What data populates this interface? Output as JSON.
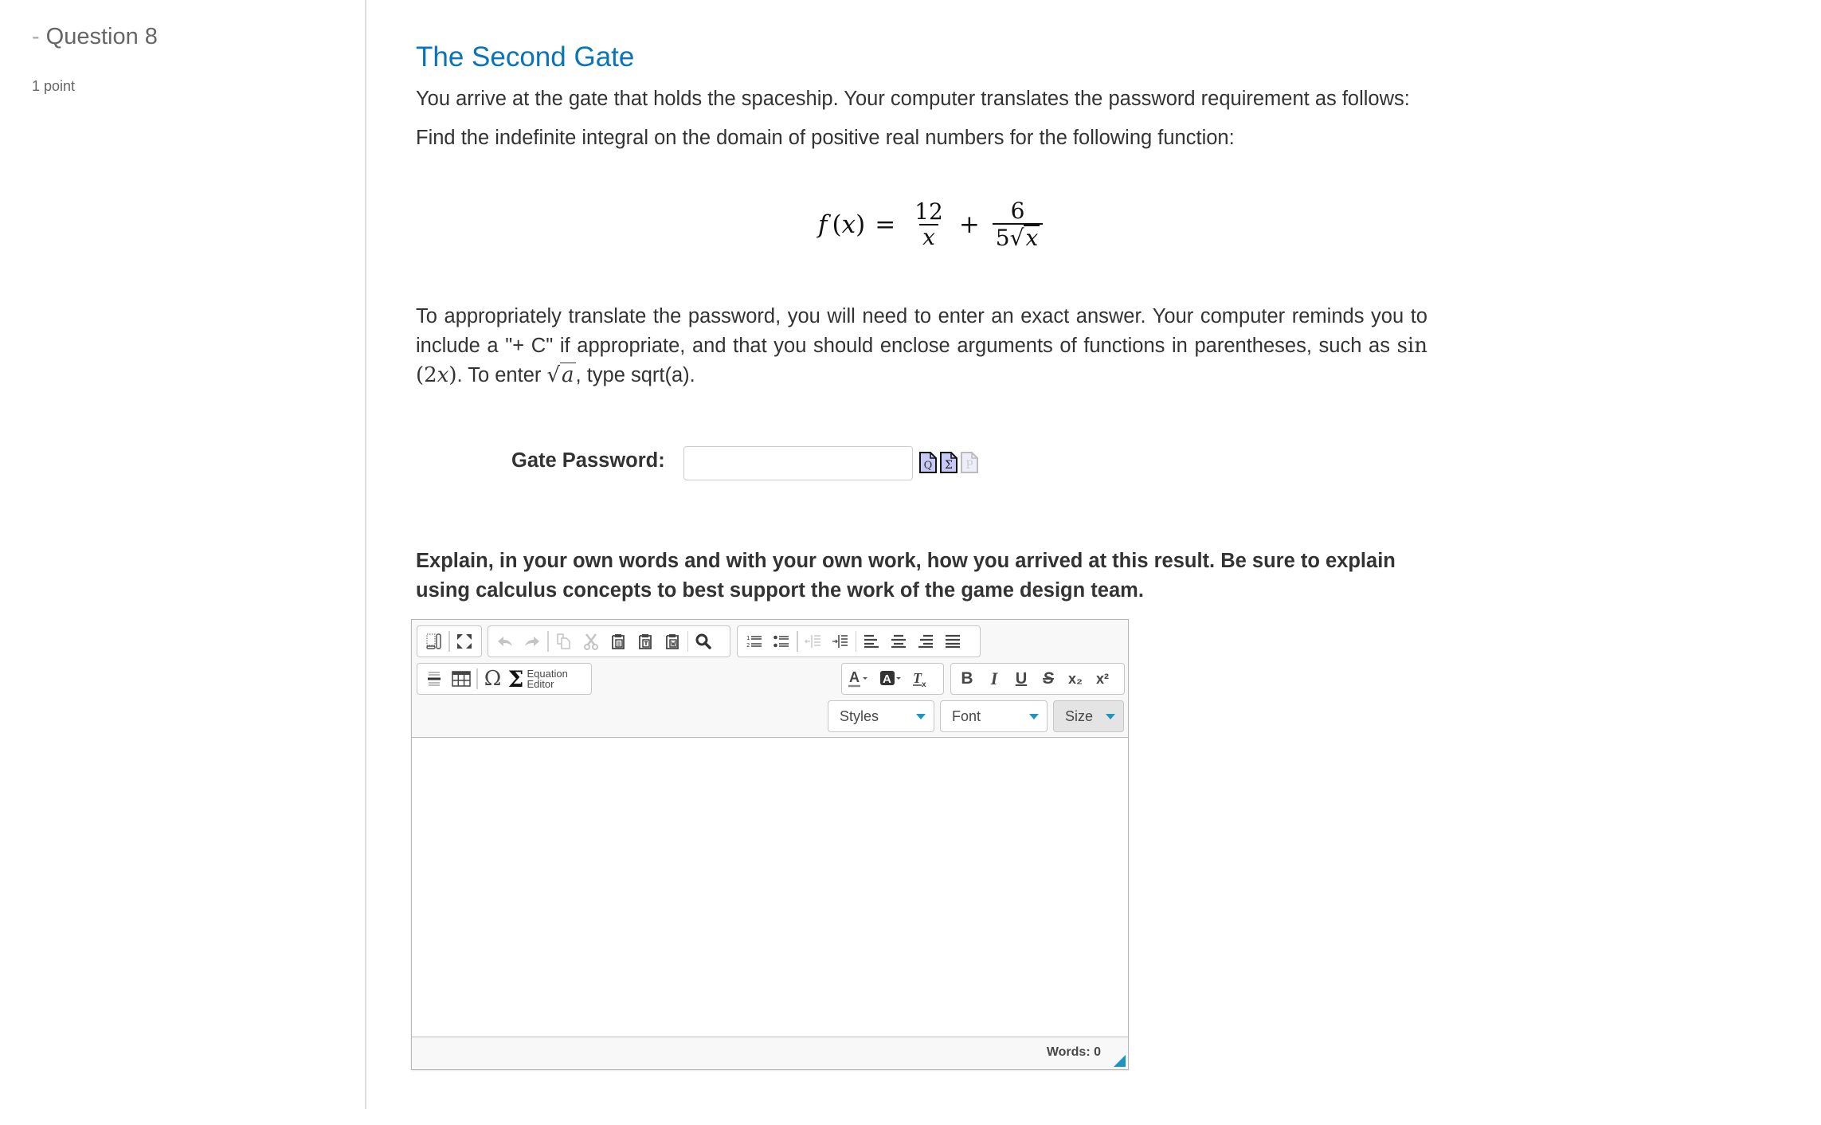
{
  "sidebar": {
    "question_title": "Question 8",
    "collapse_glyph": "-",
    "points": "1 point"
  },
  "main": {
    "title": "The Second Gate",
    "intro": "You arrive at the gate that holds the spaceship. Your computer translates the password requirement as follows:",
    "instruction": "Find the indefinite integral on the domain of positive real numbers for the following function:",
    "formula": {
      "lhs_f": "f",
      "lhs_arg": "(x)",
      "equals": "=",
      "term1_num": "12",
      "term1_den": "x",
      "plus": "+",
      "term2_num": "6",
      "term2_den_coef": "5",
      "term2_den_rad": "x"
    },
    "hint_part1": "To appropriately translate the password, you will need to enter an exact answer. Your computer reminds you to include a \"+ C\" if appropriate, and that you should enclose arguments of functions in parentheses, such as ",
    "hint_math_sin": "sin",
    "hint_math_arg_open": " (2",
    "hint_math_arg_var": "x",
    "hint_math_arg_close": ")",
    "hint_part2": ". To enter ",
    "hint_sqrt_var": "a",
    "hint_part3": ", type sqrt(a).",
    "password": {
      "label": "Gate Password:",
      "value": "",
      "placeholder": "",
      "icons": [
        "preview-icon",
        "equation-icon",
        "paste-icon"
      ],
      "icon_glyphs": [
        "Q",
        "Σ",
        "P"
      ]
    },
    "explain_prompt": "Explain, in your own words and with your own work, how you arrived at this result. Be sure to explain using calculus concepts to best support the work of the game design team."
  },
  "editor": {
    "toolbar": {
      "row1": {
        "group1": [
          {
            "name": "show-blocks",
            "glyph": "▯"
          },
          {
            "name": "maximize",
            "glyph": "⤧"
          }
        ],
        "group2": [
          {
            "name": "undo",
            "glyph": "↶",
            "disabled": true
          },
          {
            "name": "redo",
            "glyph": "↷",
            "disabled": true
          },
          {
            "name": "copy",
            "glyph": "⧉",
            "disabled": true
          },
          {
            "name": "cut",
            "glyph": "✂",
            "disabled": true
          },
          {
            "name": "paste",
            "glyph": "📋"
          },
          {
            "name": "paste-text",
            "glyph": "T"
          },
          {
            "name": "paste-word",
            "glyph": "W"
          },
          {
            "name": "find",
            "glyph": "🔍"
          }
        ],
        "group3": [
          {
            "name": "numbered-list",
            "glyph": "≡"
          },
          {
            "name": "bulleted-list",
            "glyph": "☰"
          },
          {
            "name": "outdent",
            "glyph": "⇤",
            "disabled": true
          },
          {
            "name": "indent",
            "glyph": "⇥"
          },
          {
            "name": "align-left",
            "glyph": "≡"
          },
          {
            "name": "align-center",
            "glyph": "≡"
          },
          {
            "name": "align-right",
            "glyph": "≡"
          },
          {
            "name": "justify",
            "glyph": "≡"
          }
        ]
      },
      "row2": {
        "insert_group": [
          {
            "name": "horizontal-line",
            "glyph": "☰"
          },
          {
            "name": "table",
            "glyph": "▦"
          },
          {
            "name": "special-char",
            "glyph": "Ω"
          },
          {
            "name": "equation-editor",
            "glyph": "Σ"
          }
        ],
        "equation_label_line1": "Equation",
        "equation_label_line2": "Editor",
        "color_group": [
          {
            "name": "text-color",
            "glyph": "A▾"
          },
          {
            "name": "background-color",
            "glyph": "A▾"
          },
          {
            "name": "remove-format",
            "glyph": "Tx"
          }
        ],
        "style_group": [
          {
            "name": "bold",
            "glyph": "B"
          },
          {
            "name": "italic",
            "glyph": "I"
          },
          {
            "name": "underline",
            "glyph": "U"
          },
          {
            "name": "strikethrough",
            "glyph": "S"
          },
          {
            "name": "subscript",
            "glyph": "x₂"
          },
          {
            "name": "superscript",
            "glyph": "x²"
          }
        ]
      },
      "row3": {
        "styles": "Styles",
        "font": "Font",
        "size": "Size"
      }
    },
    "content": "",
    "word_count": "Words: 0",
    "accent_color": "#1a96c4"
  },
  "colors": {
    "title": "#0a74b8",
    "body_text": "#333333",
    "sidebar_text": "#666666"
  }
}
